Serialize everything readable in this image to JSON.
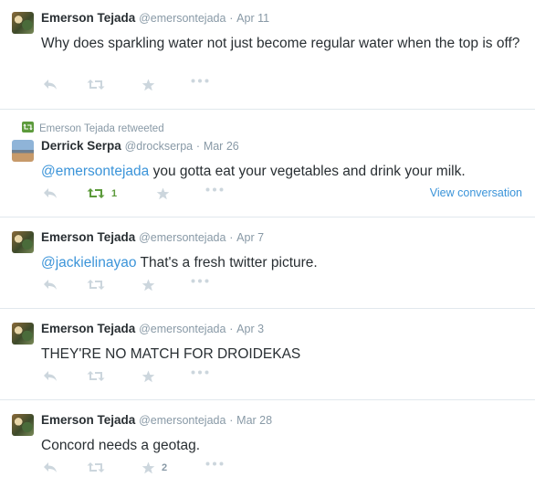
{
  "tweets": [
    {
      "name": "Emerson Tejada",
      "handle": "@emersontejada",
      "dot": "·",
      "date": "Apr 11",
      "text": "Why does sparkling water not just become regular water when the top is off?",
      "mention": ""
    },
    {
      "retweet_context": "Emerson Tejada retweeted",
      "name": "Derrick Serpa",
      "handle": "@drockserpa",
      "dot": "·",
      "date": "Mar 26",
      "mention": "@emersontejada",
      "text": " you gotta eat your vegetables and drink your milk.",
      "retweet_count": "1",
      "view_conversation": "View conversation"
    },
    {
      "name": "Emerson Tejada",
      "handle": "@emersontejada",
      "dot": "·",
      "date": "Apr 7",
      "mention": "@jackielinayao",
      "text": " That's a fresh twitter picture."
    },
    {
      "name": "Emerson Tejada",
      "handle": "@emersontejada",
      "dot": "·",
      "date": "Apr 3",
      "text": "THEY'RE NO MATCH FOR DROIDEKAS"
    },
    {
      "name": "Emerson Tejada",
      "handle": "@emersontejada",
      "dot": "·",
      "date": "Mar 28",
      "text": "Concord needs a geotag.",
      "favorite_count": "2"
    }
  ],
  "colors": {
    "link": "#3b94d9",
    "retweet_active": "#5c9a3b",
    "muted": "#8899a6",
    "icon": "#ccd6dd",
    "divider": "#e1e8ed"
  }
}
